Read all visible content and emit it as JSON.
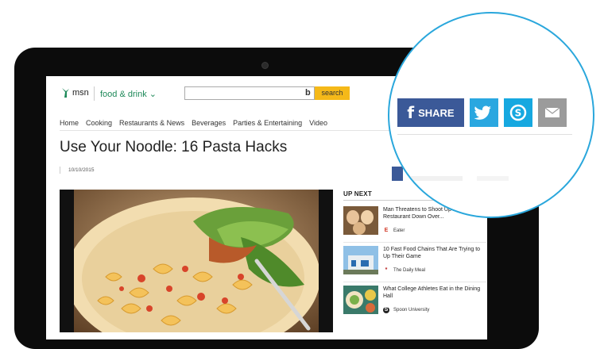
{
  "header": {
    "logo_text": "msn",
    "section_label": "food & drink",
    "search_placeholder": "",
    "search_button": "search"
  },
  "nav": [
    "Home",
    "Cooking",
    "Restaurants & News",
    "Beverages",
    "Parties & Entertaining",
    "Video"
  ],
  "article": {
    "title": "Use Your Noodle: 16 Pasta Hacks",
    "date": "10/10/2015"
  },
  "up_next": {
    "heading": "UP NEXT",
    "items": [
      {
        "title": "Man Threatens to Shoot Up and Burn Restaurant Down Over...",
        "source": "Eater",
        "source_icon": "E"
      },
      {
        "title": "10 Fast Food Chains That Are Trying to Up Their Game",
        "source": "The Daily Meal",
        "source_icon": "*"
      },
      {
        "title": "What College Athletes Eat in the Dining Hall",
        "source": "Spoon University",
        "source_icon": "S"
      }
    ]
  },
  "share": {
    "facebook_label": "SHARE",
    "icons": [
      "facebook-icon",
      "twitter-icon",
      "skype-icon",
      "email-icon"
    ],
    "colors": {
      "facebook": "#3b5998",
      "twitter": "#2aa7e0",
      "skype": "#16a8e0",
      "email": "#9b9b9b",
      "ring": "#2aa7dc"
    }
  }
}
